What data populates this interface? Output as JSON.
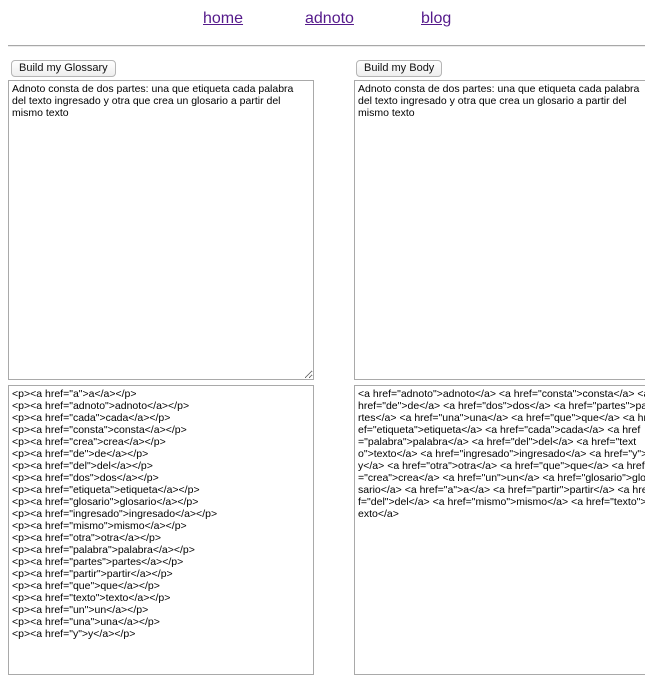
{
  "nav": {
    "home": "home",
    "adnoto": "adnoto",
    "blog": "blog"
  },
  "buttons": {
    "glossary": "Build my Glossary",
    "body": "Build my Body"
  },
  "inputs": {
    "left_text": "Adnoto consta de dos partes: una que etiqueta cada palabra del texto ingresado y otra que crea un glosario a partir del mismo texto",
    "right_text": "Adnoto consta de dos partes: una que etiqueta cada palabra del texto ingresado y otra que crea un glosario a partir del mismo texto"
  },
  "glossary_output": [
    "<p><a href=\"a\">a</a></p>",
    "<p><a href=\"adnoto\">adnoto</a></p>",
    "<p><a href=\"cada\">cada</a></p>",
    "<p><a href=\"consta\">consta</a></p>",
    "<p><a href=\"crea\">crea</a></p>",
    "<p><a href=\"de\">de</a></p>",
    "<p><a href=\"del\">del</a></p>",
    "<p><a href=\"dos\">dos</a></p>",
    "<p><a href=\"etiqueta\">etiqueta</a></p>",
    "<p><a href=\"glosario\">glosario</a></p>",
    "<p><a href=\"ingresado\">ingresado</a></p>",
    "<p><a href=\"mismo\">mismo</a></p>",
    "<p><a href=\"otra\">otra</a></p>",
    "<p><a href=\"palabra\">palabra</a></p>",
    "<p><a href=\"partes\">partes</a></p>",
    "<p><a href=\"partir\">partir</a></p>",
    "<p><a href=\"que\">que</a></p>",
    "<p><a href=\"texto\">texto</a></p>",
    "<p><a href=\"un\">un</a></p>",
    "<p><a href=\"una\">una</a></p>",
    "<p><a href=\"y\">y</a></p>"
  ],
  "body_output": "<a href=\"adnoto\">adnoto</a> <a href=\"consta\">consta</a> <a href=\"de\">de</a> <a href=\"dos\">dos</a> <a href=\"partes\">partes</a> <a href=\"una\">una</a> <a href=\"que\">que</a> <a href=\"etiqueta\">etiqueta</a> <a href=\"cada\">cada</a> <a href=\"palabra\">palabra</a> <a href=\"del\">del</a> <a href=\"texto\">texto</a> <a href=\"ingresado\">ingresado</a> <a href=\"y\">y</a> <a href=\"otra\">otra</a> <a href=\"que\">que</a> <a href=\"crea\">crea</a> <a href=\"un\">un</a> <a href=\"glosario\">glosario</a> <a href=\"a\">a</a> <a href=\"partir\">partir</a> <a href=\"del\">del</a> <a href=\"mismo\">mismo</a> <a href=\"texto\">texto</a>"
}
